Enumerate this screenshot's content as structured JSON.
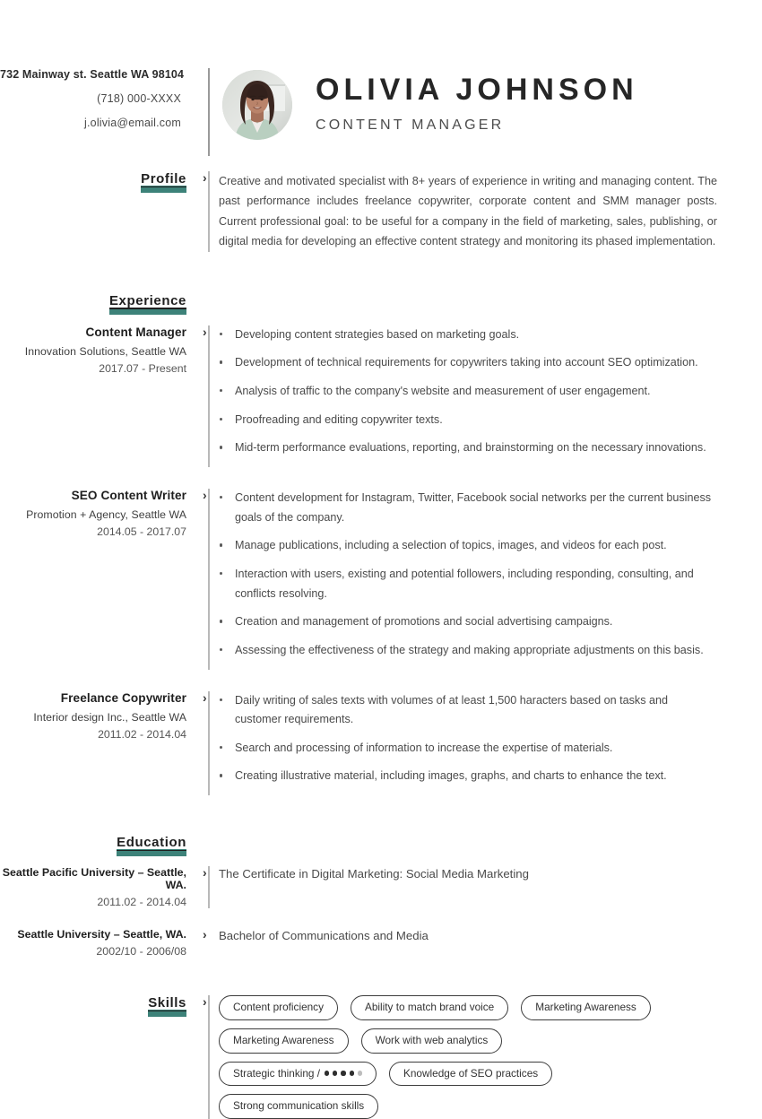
{
  "header": {
    "address": "732 Mainway st. Seattle WA 98104",
    "phone": "(718) 000-XXXX",
    "email": "j.olivia@email.com",
    "name": "OLIVIA  JOHNSON",
    "job_title": "CONTENT MANAGER",
    "avatar_alt": "portrait-photo"
  },
  "sections": {
    "profile": {
      "heading": "Profile",
      "text": "Creative and motivated specialist with 8+ years of experience in writing and managing content. The past performance includes freelance copywriter, corporate content and SMM manager posts.  Current professional goal: to be useful for a company in the field of marketing, sales, publishing, or digital media for developing an effective content strategy and monitoring its phased implementation."
    },
    "experience": {
      "heading": "Experience",
      "jobs": [
        {
          "title": "Content Manager",
          "company": "Innovation Solutions, Seattle WA",
          "dates": "2017.07 - Present",
          "bullets": [
            "Developing content strategies based on marketing goals.",
            "Development of technical requirements for copywriters taking into account SEO optimization.",
            "Analysis of traffic to the company's website and measurement of user engagement.",
            "Proofreading and editing copywriter texts.",
            "Mid-term performance evaluations, reporting, and brainstorming on the necessary innovations."
          ]
        },
        {
          "title": "SEO Content Writer",
          "company": "Promotion + Agency, Seattle WA",
          "dates": "2014.05 - 2017.07",
          "bullets": [
            "Content development for Instagram, Twitter, Facebook social networks per the current business goals of the company.",
            "Manage publications, including a selection of topics, images, and videos for each post.",
            "Interaction with users, existing and potential followers, including responding, consulting, and conflicts resolving.",
            "Creation and management of promotions and social advertising campaigns.",
            "Assessing the effectiveness of the strategy and making appropriate adjustments on this basis."
          ]
        },
        {
          "title": "Freelance Copywriter",
          "company": "Interior design Inc., Seattle WA",
          "dates": "2011.02 - 2014.04",
          "bullets": [
            "Daily writing of sales texts with volumes of at least 1,500 haracters based on tasks and customer requirements.",
            "Search and processing of information to increase the expertise of materials.",
            "Creating illustrative material, including images, graphs, and charts to enhance the text."
          ]
        }
      ]
    },
    "education": {
      "heading": "Education",
      "items": [
        {
          "school": "Seattle Pacific University – Seattle, WA.",
          "dates": "2011.02 - 2014.04",
          "degree": "The Certificate in Digital Marketing: Social Media Marketing"
        },
        {
          "school": "Seattle University – Seattle, WA.",
          "dates": "2002/10 - 2006/08",
          "degree": "Bachelor of Communications and Media"
        }
      ]
    },
    "skills": {
      "heading": "Skills",
      "items": [
        {
          "label": "Content proficiency",
          "rating_filled": 0,
          "rating_total": 0
        },
        {
          "label": "Ability to match brand voice",
          "rating_filled": 0,
          "rating_total": 0
        },
        {
          "label": "Marketing Awareness",
          "rating_filled": 0,
          "rating_total": 0
        },
        {
          "label": "Marketing Awareness",
          "rating_filled": 0,
          "rating_total": 0
        },
        {
          "label": "Work with web analytics",
          "rating_filled": 0,
          "rating_total": 0
        },
        {
          "label": "Strategic thinking /",
          "rating_filled": 4,
          "rating_total": 5
        },
        {
          "label": "Knowledge of SEO practices",
          "rating_filled": 0,
          "rating_total": 0
        },
        {
          "label": "Strong communication skills",
          "rating_filled": 0,
          "rating_total": 0
        }
      ]
    }
  },
  "icons": {
    "chevron": "›"
  },
  "colors": {
    "accent_teal": "#3d8279",
    "heading_dark": "#1f1f1f",
    "body_text": "#4a4a4a",
    "rule_gray": "#b9b9b9"
  }
}
